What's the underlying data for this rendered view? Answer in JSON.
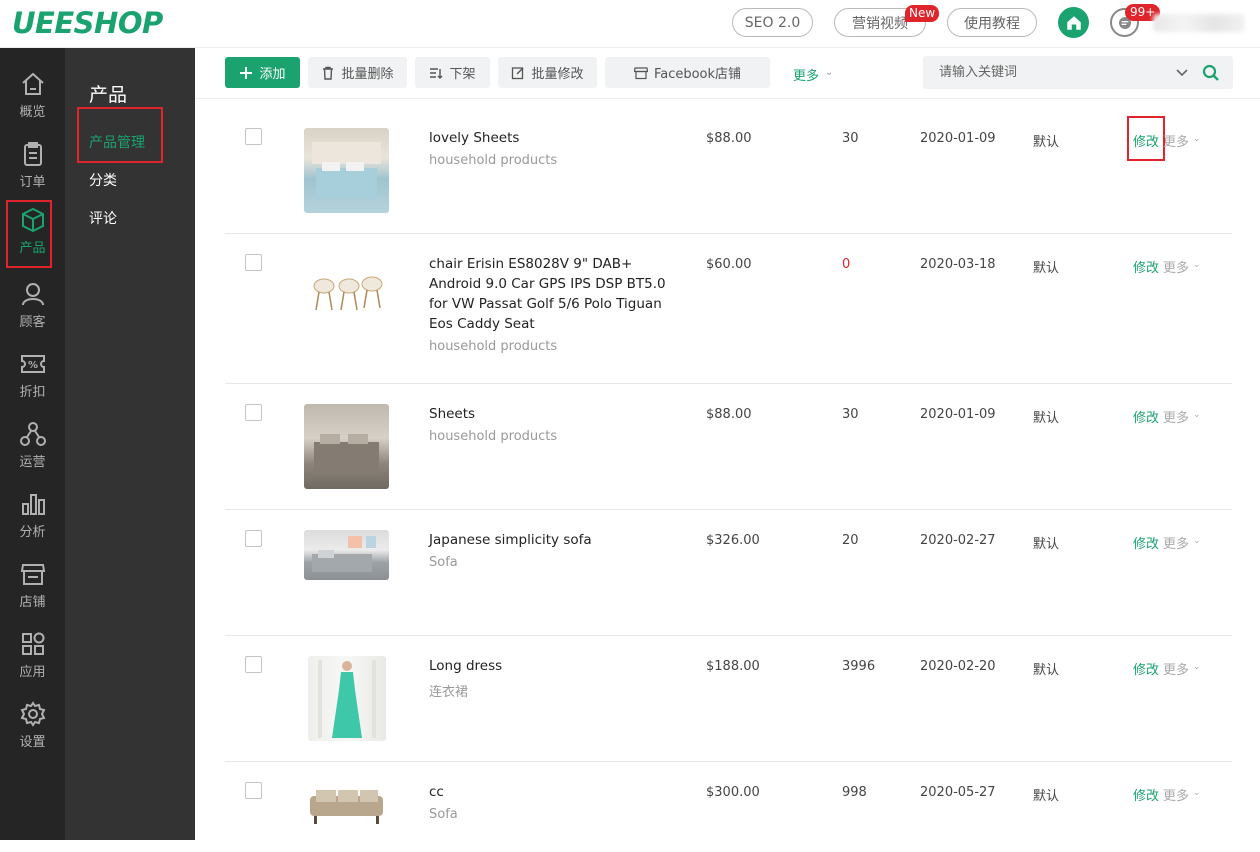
{
  "header": {
    "logo": "UEESHOP",
    "seo_label": "SEO 2.0",
    "video_label": "营销视频",
    "new_badge": "New",
    "tutorial_label": "使用教程",
    "msg_badge": "99+"
  },
  "rail": {
    "items": [
      {
        "label": "概览",
        "icon": "home-outline-icon"
      },
      {
        "label": "订单",
        "icon": "clipboard-icon"
      },
      {
        "label": "产品",
        "icon": "cube-icon"
      },
      {
        "label": "顾客",
        "icon": "user-icon"
      },
      {
        "label": "折扣",
        "icon": "percent-tag-icon"
      },
      {
        "label": "运营",
        "icon": "network-icon"
      },
      {
        "label": "分析",
        "icon": "bar-chart-icon"
      },
      {
        "label": "店铺",
        "icon": "store-icon"
      },
      {
        "label": "应用",
        "icon": "apps-icon"
      },
      {
        "label": "设置",
        "icon": "gear-icon"
      }
    ]
  },
  "submenu": {
    "title": "产品",
    "items": [
      "产品管理",
      "分类",
      "评论"
    ]
  },
  "toolbar": {
    "add": "添加",
    "batch_delete": "批量删除",
    "unlist": "下架",
    "batch_edit": "批量修改",
    "facebook": "Facebook店铺",
    "more": "更多",
    "search_placeholder": "请输入关键词"
  },
  "products": [
    {
      "name": "lovely Sheets",
      "category": "household products",
      "price": "$88.00",
      "stock": "30",
      "date": "2020-01-09",
      "status": "默认",
      "edit": "修改",
      "more": "更多"
    },
    {
      "name": "chair Erisin ES8028V 9\" DAB+ Android 9.0 Car GPS IPS DSP BT5.0 for VW Passat Golf 5/6 Polo Tiguan Eos Caddy Seat",
      "category": "household products",
      "price": "$60.00",
      "stock": "0",
      "date": "2020-03-18",
      "status": "默认",
      "edit": "修改",
      "more": "更多"
    },
    {
      "name": "Sheets",
      "category": "household products",
      "price": "$88.00",
      "stock": "30",
      "date": "2020-01-09",
      "status": "默认",
      "edit": "修改",
      "more": "更多"
    },
    {
      "name": "Japanese simplicity sofa",
      "category": "Sofa",
      "price": "$326.00",
      "stock": "20",
      "date": "2020-02-27",
      "status": "默认",
      "edit": "修改",
      "more": "更多"
    },
    {
      "name": "Long dress",
      "category": "连衣裙",
      "price": "$188.00",
      "stock": "3996",
      "date": "2020-02-20",
      "status": "默认",
      "edit": "修改",
      "more": "更多"
    },
    {
      "name": "cc",
      "category": "Sofa",
      "price": "$300.00",
      "stock": "998",
      "date": "2020-05-27",
      "status": "默认",
      "edit": "修改",
      "more": "更多"
    }
  ],
  "colors": {
    "brand": "#1aa36f",
    "alert": "#e0242b",
    "sidebar": "#252525",
    "submenu": "#333333"
  }
}
